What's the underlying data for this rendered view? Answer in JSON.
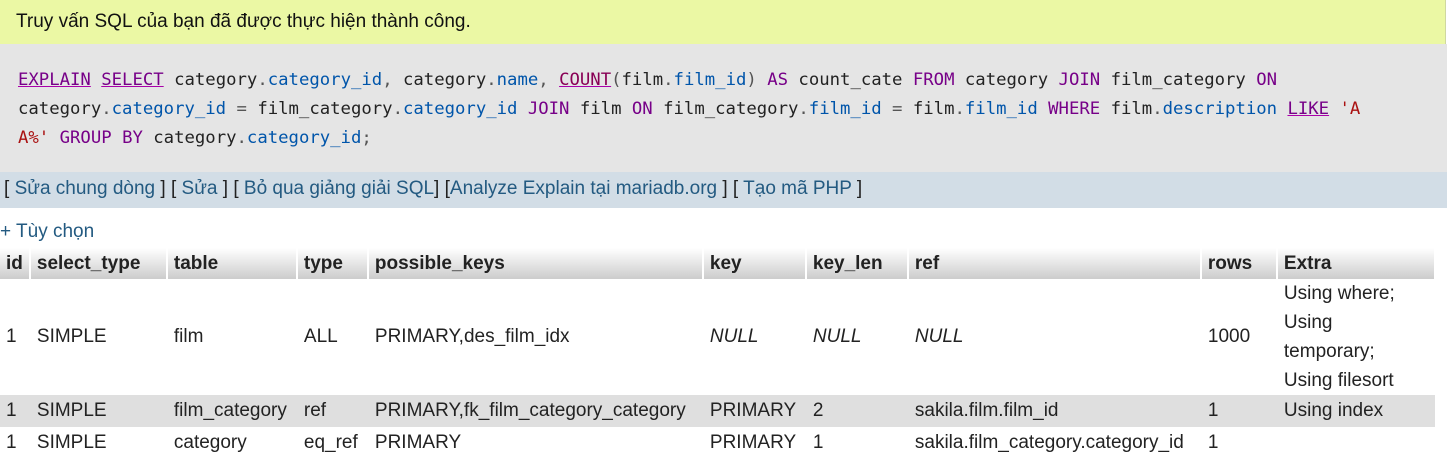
{
  "message": {
    "success_text": "Truy vấn SQL của bạn đã được thực hiện thành công."
  },
  "sql": {
    "tokens": {
      "explain": "EXPLAIN",
      "select": "SELECT",
      "from": "FROM",
      "join": "JOIN",
      "on": "ON",
      "where": "WHERE",
      "like": "LIKE",
      "group": "GROUP",
      "by": "BY",
      "as": "AS",
      "count": "COUNT",
      "category": "category",
      "category_id": "category_id",
      "name": "name",
      "film": "film",
      "film_id": "film_id",
      "count_cate": "count_cate",
      "film_category": "film_category",
      "description": "description",
      "string_start": "'A",
      "string_end": "A%'"
    }
  },
  "links": {
    "inline_edit": "Sửa chung dòng",
    "edit": "Sửa",
    "skip_explain": "Bỏ qua giảng giải SQL",
    "analyze": "Analyze Explain tại mariadb.org",
    "create_php": "Tạo mã PHP"
  },
  "options_label": "+ Tùy chọn",
  "table": {
    "headers": [
      "id",
      "select_type",
      "table",
      "type",
      "possible_keys",
      "key",
      "key_len",
      "ref",
      "rows",
      "Extra"
    ],
    "rows": [
      {
        "id": "1",
        "select_type": "SIMPLE",
        "table": "film",
        "type": "ALL",
        "possible_keys": "PRIMARY,des_film_idx",
        "key": "NULL",
        "key_len": "NULL",
        "ref": "NULL",
        "rows": "1000",
        "extra": [
          "Using where;",
          "Using temporary;",
          "Using filesort"
        ]
      },
      {
        "id": "1",
        "select_type": "SIMPLE",
        "table": "film_category",
        "type": "ref",
        "possible_keys": "PRIMARY,fk_film_category_category",
        "key": "PRIMARY",
        "key_len": "2",
        "ref": "sakila.film.film_id",
        "rows": "1",
        "extra": [
          "Using index"
        ]
      },
      {
        "id": "1",
        "select_type": "SIMPLE",
        "table": "category",
        "type": "eq_ref",
        "possible_keys": "PRIMARY",
        "key": "PRIMARY",
        "key_len": "1",
        "ref": "sakila.film_category.category_id",
        "rows": "1",
        "extra": []
      }
    ]
  }
}
